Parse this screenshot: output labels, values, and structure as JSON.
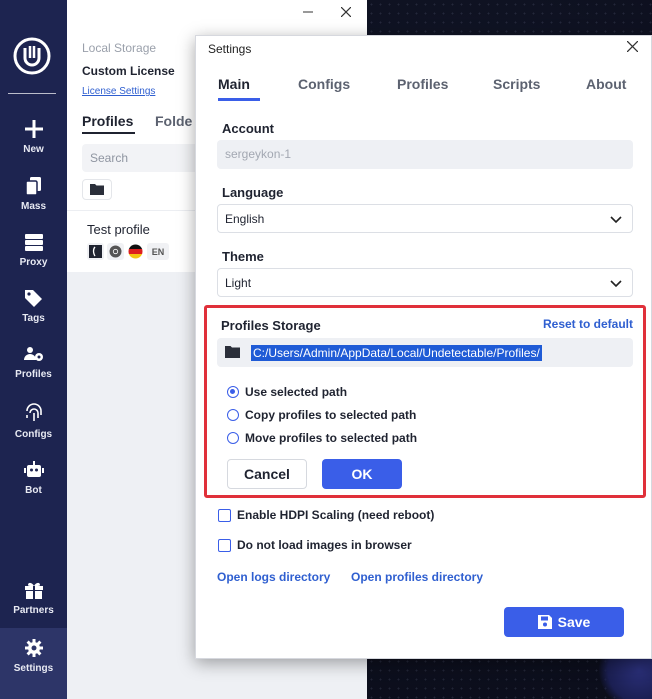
{
  "app": {
    "sidebar": {
      "items": [
        {
          "label": "New",
          "icon": "plus-icon"
        },
        {
          "label": "Mass",
          "icon": "copy-icon"
        },
        {
          "label": "Proxy",
          "icon": "server-icon"
        },
        {
          "label": "Tags",
          "icon": "tags-icon"
        },
        {
          "label": "Profiles",
          "icon": "users-gear-icon"
        },
        {
          "label": "Configs",
          "icon": "fingerprint-icon"
        },
        {
          "label": "Bot",
          "icon": "robot-icon"
        },
        {
          "label": "Partners",
          "icon": "gift-icon"
        },
        {
          "label": "Settings",
          "icon": "gear-icon",
          "active": true
        }
      ]
    },
    "panel": {
      "storage_title": "Local Storage",
      "license": "Custom License",
      "license_link": "License Settings",
      "tabs": [
        "Profiles",
        "Folde"
      ],
      "search_placeholder": "Search",
      "profile": {
        "name": "Test profile",
        "lang": "EN"
      }
    }
  },
  "dialog": {
    "title": "Settings",
    "tabs": [
      "Main",
      "Configs",
      "Profiles",
      "Scripts",
      "About"
    ],
    "active_tab": "Main",
    "account_label": "Account",
    "account_value": "sergeykon-1",
    "language_label": "Language",
    "language_value": "English",
    "theme_label": "Theme",
    "theme_value": "Light",
    "storage": {
      "label": "Profiles Storage",
      "reset": "Reset to default",
      "path": "C:/Users/Admin/AppData/Local/Undetectable/Profiles/",
      "options": [
        {
          "label": "Use selected path",
          "selected": true
        },
        {
          "label": "Copy profiles to selected path",
          "selected": false
        },
        {
          "label": "Move profiles to selected path",
          "selected": false
        }
      ],
      "cancel": "Cancel",
      "ok": "OK"
    },
    "hdpi_label": "Enable HDPI Scaling (need reboot)",
    "no_images_label": "Do not load images in browser",
    "open_logs": "Open logs directory",
    "open_profiles": "Open profiles directory",
    "save": "Save"
  },
  "colors": {
    "accent": "#3a5ee8",
    "sidebar": "#1d2450",
    "highlight_border": "#e0303a"
  }
}
